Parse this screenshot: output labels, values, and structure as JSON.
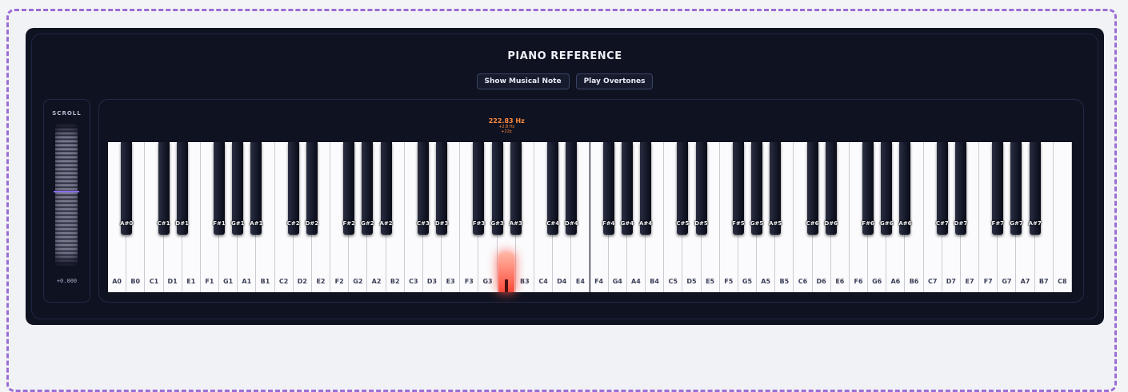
{
  "title": "PIANO REFERENCE",
  "buttons": {
    "show_note": "Show Musical Note",
    "overtones": "Play Overtones"
  },
  "scroll": {
    "label": "SCROLL",
    "value": "+0.000"
  },
  "frequency": {
    "hz": "222.83 Hz",
    "offset_hz": "+2.8 Hz",
    "cents": "+22¢"
  },
  "highlight_key": "A3",
  "colors": {
    "accent": "#8b6cf0",
    "frequency": "#ff8a3d",
    "highlight": "#ff4a3a",
    "panel": "#0f1221"
  },
  "white_keys": [
    "A0",
    "B0",
    "C1",
    "D1",
    "E1",
    "F1",
    "G1",
    "A1",
    "B1",
    "C2",
    "D2",
    "E2",
    "F2",
    "G2",
    "A2",
    "B2",
    "C3",
    "D3",
    "E3",
    "F3",
    "G3",
    "A3",
    "B3",
    "C4",
    "D4",
    "E4",
    "F4",
    "G4",
    "A4",
    "B4",
    "C5",
    "D5",
    "E5",
    "F5",
    "G5",
    "A5",
    "B5",
    "C6",
    "D6",
    "E6",
    "F6",
    "G6",
    "A6",
    "B6",
    "C7",
    "D7",
    "E7",
    "F7",
    "G7",
    "A7",
    "B7",
    "C8"
  ],
  "black_keys": [
    "A#0",
    "C#1",
    "D#1",
    "F#1",
    "G#1",
    "A#1",
    "C#2",
    "D#2",
    "F#2",
    "G#2",
    "A#2",
    "C#3",
    "D#3",
    "F#3",
    "G#3",
    "A#3",
    "C#4",
    "D#4",
    "F#4",
    "G#4",
    "A#4",
    "C#5",
    "D#5",
    "F#5",
    "G#5",
    "A#5",
    "C#6",
    "D#6",
    "F#6",
    "G#6",
    "A#6",
    "C#7",
    "D#7",
    "F#7",
    "G#7",
    "A#7"
  ]
}
